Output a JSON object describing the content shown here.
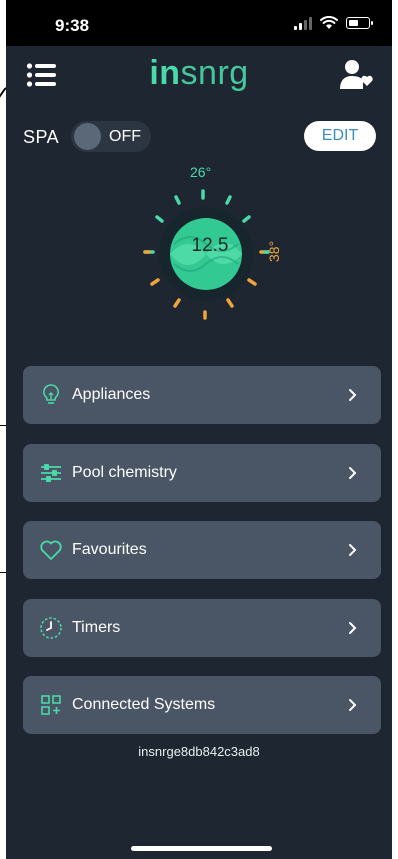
{
  "status": {
    "time": "9:38"
  },
  "header": {
    "logo_accent": "in",
    "logo_rest": "snrg",
    "menu_icon": "hamburger-menu-icon",
    "user_icon": "user-favourite-icon"
  },
  "spa": {
    "label": "SPA",
    "toggle_state": "OFF",
    "edit_label": "EDIT"
  },
  "dial": {
    "current_value": "12.5",
    "top_label": "26°",
    "side_label": "38°"
  },
  "menu": [
    {
      "label": "Appliances",
      "icon": "lightbulb-icon"
    },
    {
      "label": "Pool chemistry",
      "icon": "sliders-icon"
    },
    {
      "label": "Favourites",
      "icon": "heart-icon"
    },
    {
      "label": "Timers",
      "icon": "timer-icon"
    },
    {
      "label": "Connected Systems",
      "icon": "grid-plus-icon"
    }
  ],
  "device_id": "insnrge8db842c3ad8",
  "colors": {
    "background": "#1d2631",
    "accent": "#4ad9a8",
    "warm": "#f0a53a",
    "card": "#4a5565"
  }
}
